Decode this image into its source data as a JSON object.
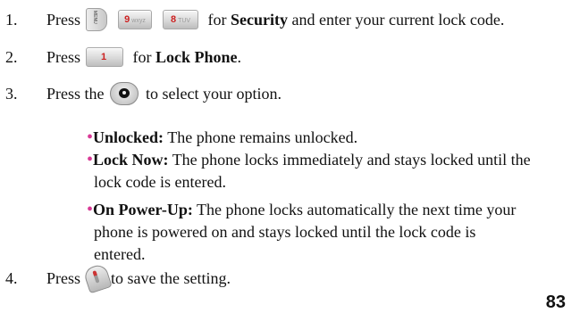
{
  "steps": [
    {
      "number": "1.",
      "prefix": "Press",
      "mid": " for ",
      "bold": "Security",
      "suffix": " and enter your current lock code.",
      "keys": {
        "menu": "MENU",
        "k9_num": "9",
        "k9_letters": "wxyz",
        "k8_num": "8",
        "k8_letters": "TUV"
      }
    },
    {
      "number": "2.",
      "prefix": "Press",
      "mid": " for ",
      "bold": "Lock Phone",
      "suffix": ".",
      "key1": "1"
    },
    {
      "number": "3.",
      "prefix": "Press the",
      "suffix": " to select your option."
    },
    {
      "number": "4.",
      "prefix": "Press",
      "suffix": "to save the setting."
    }
  ],
  "options": [
    {
      "label": "Unlocked:",
      "text": " The phone remains unlocked."
    },
    {
      "label": "Lock Now:",
      "text": " The phone locks immediately and stays locked until the",
      "continuation": "lock code is entered."
    },
    {
      "label": "On Power-Up:",
      "text": " The phone locks automatically the next time your",
      "continuation": "phone is powered on and stays locked until the lock code is",
      "continuation2": "entered."
    }
  ],
  "bullet_char": "•",
  "page_number": "83",
  "colors": {
    "bullet": "#d93a96",
    "key_digit": "#c22"
  },
  "icons": [
    "menu-key-icon",
    "key-9-icon",
    "key-8-icon",
    "key-1-icon",
    "navigation-key-icon",
    "end-key-icon"
  ]
}
